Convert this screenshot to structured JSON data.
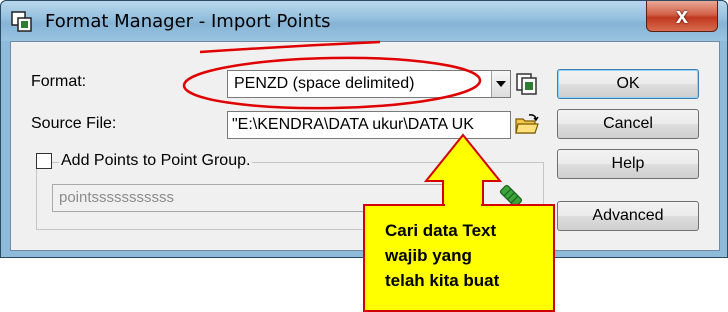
{
  "window": {
    "title": "Format Manager - Import Points",
    "close_glyph": "x"
  },
  "form": {
    "format_label": "Format:",
    "format_value": "PENZD (space delimited)",
    "source_label": "Source File:",
    "source_value": "\"E:\\KENDRA\\DATA ukur\\DATA UK",
    "group_checkbox_label": "Add Points to Point Group.",
    "group_checkbox_checked": false,
    "group_name_value": "pointsssssssssss"
  },
  "buttons": {
    "ok": "OK",
    "cancel": "Cancel",
    "help": "Help",
    "advanced": "Advanced"
  },
  "annotation": {
    "line1": "Cari data Text",
    "line2": "wajib yang",
    "line3": "telah kita buat",
    "fill_color": "#ffff00",
    "stroke_color": "#d40000"
  },
  "icons": {
    "title": "format-manager-icon",
    "format_manage": "format-manager-icon",
    "browse": "open-folder-icon",
    "group_select": "point-group-icon"
  }
}
